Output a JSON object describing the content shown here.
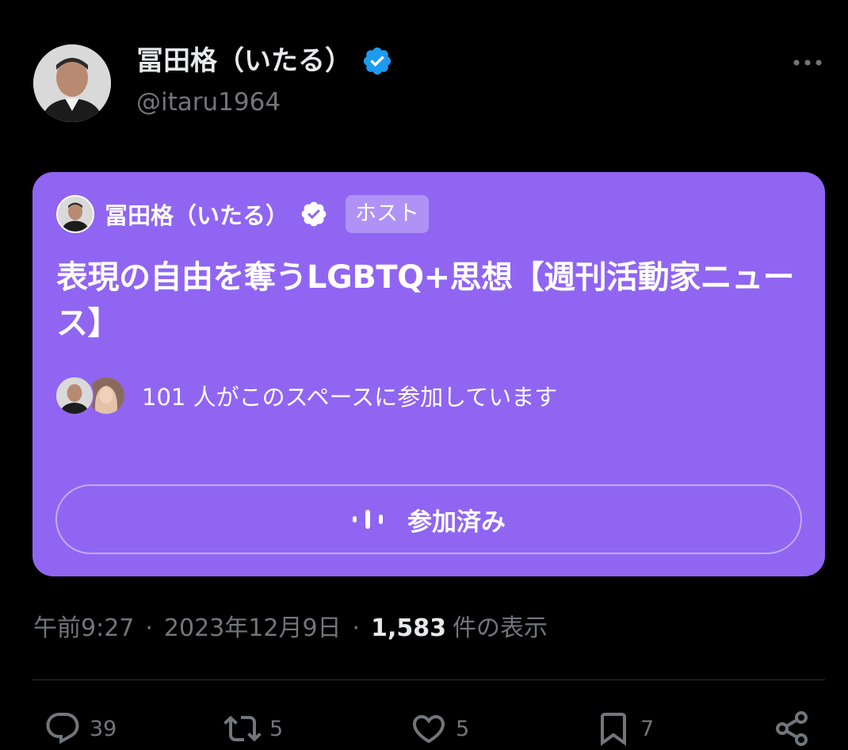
{
  "author": {
    "name": "冨田格（いたる）",
    "handle": "@itaru1964",
    "verified_color": "#1d9bf0"
  },
  "space": {
    "host_name": "冨田格（いたる）",
    "host_badge": "ホスト",
    "title": "表現の自由を奪うLGBTQ+思想【週刊活動家ニュース】",
    "listeners_text": "101 人がこのスペースに参加しています",
    "join_button_label": "参加済み",
    "card_color": "#9065f2"
  },
  "meta": {
    "time": "午前9:27",
    "separator": "·",
    "date": "2023年12月9日",
    "views_count": "1,583",
    "views_label": "件の表示"
  },
  "actions": {
    "reply_count": "39",
    "retweet_count": "5",
    "like_count": "5",
    "bookmark_count": "7"
  },
  "icons": {
    "more": "more-horizontal-icon",
    "verified": "verified-badge-icon",
    "audio_bars": "audio-bars-icon",
    "reply": "reply-icon",
    "retweet": "retweet-icon",
    "like": "heart-icon",
    "bookmark": "bookmark-icon",
    "share": "share-icon"
  }
}
